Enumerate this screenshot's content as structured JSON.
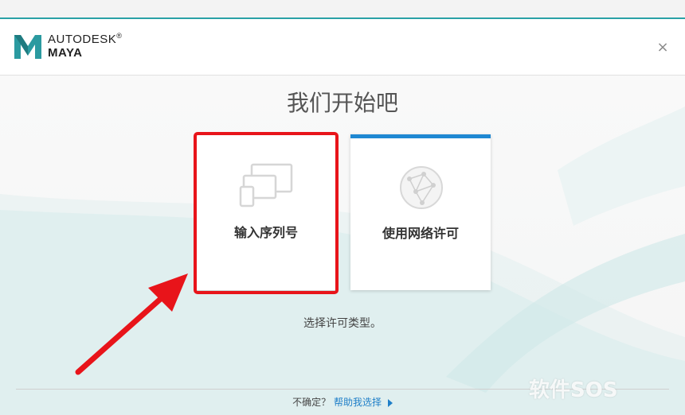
{
  "header": {
    "brand_line1": "AUTODESK",
    "brand_registered": "®",
    "brand_line2": "MAYA",
    "close_label": "×"
  },
  "main": {
    "title": "我们开始吧",
    "cards": [
      {
        "label": "输入序列号",
        "icon": "devices-icon",
        "highlighted": true
      },
      {
        "label": "使用网络许可",
        "icon": "network-globe-icon",
        "accent": "#1f88d2"
      }
    ],
    "hint": "选择许可类型。"
  },
  "footer": {
    "question": "不确定？",
    "help_link": "帮助我选择"
  },
  "watermark": "软件SOS",
  "colors": {
    "accent": "#2aa1a6",
    "link": "#1f7fc8",
    "highlight": "#e8141a"
  }
}
